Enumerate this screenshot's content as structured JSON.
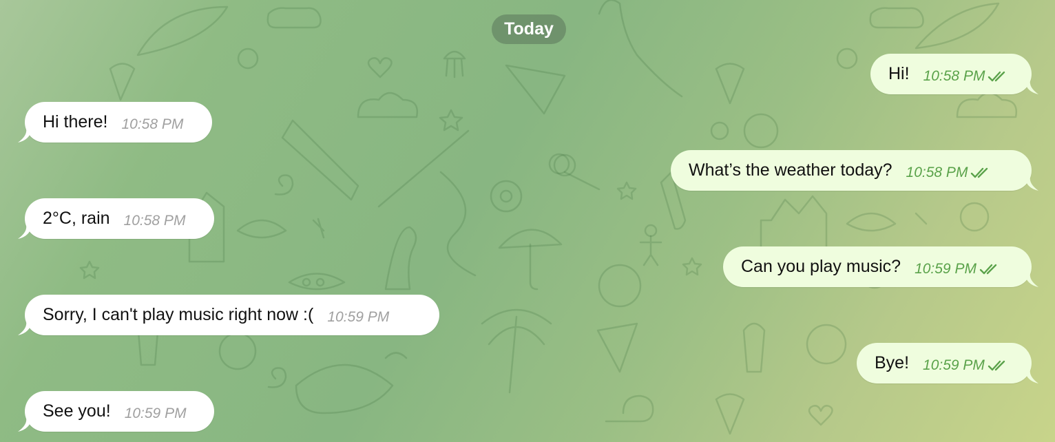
{
  "chat": {
    "date_label": "Today",
    "colors": {
      "incoming_bubble": "#ffffff",
      "outgoing_bubble": "#effdde",
      "outgoing_time": "#5aa24a",
      "incoming_time": "#a0a0a0"
    },
    "incoming": [
      {
        "text": "Hi there!",
        "time": "10:58 PM"
      },
      {
        "text": "2°C, rain",
        "time": "10:58 PM"
      },
      {
        "text": "Sorry, I can't play music right now :(",
        "time": "10:59 PM"
      },
      {
        "text": "See you!",
        "time": "10:59 PM"
      }
    ],
    "outgoing": [
      {
        "text": "Hi!",
        "time": "10:58 PM",
        "status_icon": "double-check-icon"
      },
      {
        "text": "What’s the weather today?",
        "time": "10:58 PM",
        "status_icon": "double-check-icon"
      },
      {
        "text": "Can you play music?",
        "time": "10:59 PM",
        "status_icon": "double-check-icon"
      },
      {
        "text": "Bye!",
        "time": "10:59 PM",
        "status_icon": "double-check-icon"
      }
    ]
  }
}
